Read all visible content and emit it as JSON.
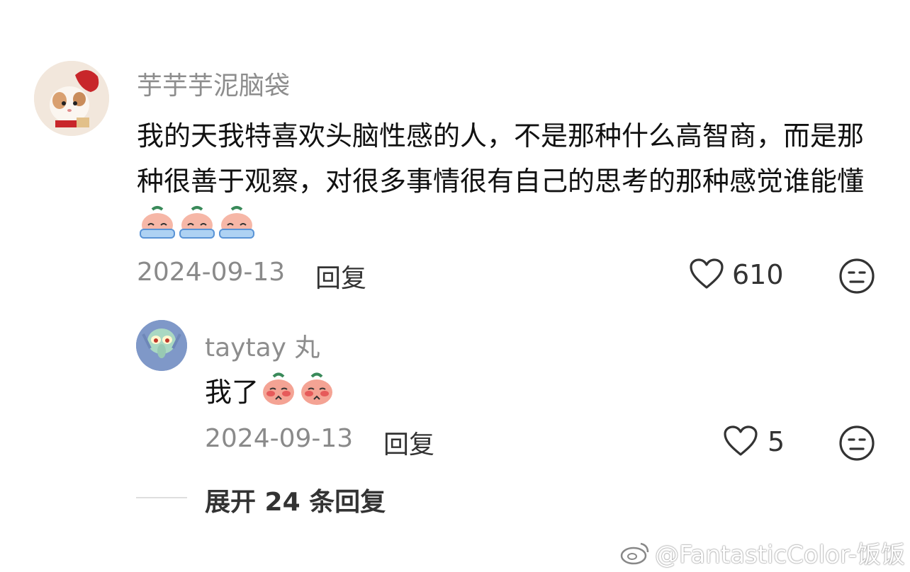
{
  "main_comment": {
    "username": "芋芋芋泥脑袋",
    "text": "我的天我特喜欢头脑性感的人，不是那种什么高智商，而是那种很善于观察，对很多事情很有自己的思考的那种感觉谁能懂",
    "emoji": "crying-emoji",
    "emoji_count": 3,
    "date": "2024-09-13",
    "reply_label": "回复",
    "likes": "610",
    "icons": {
      "like": "heart-outline-icon",
      "reaction": "meh-face-icon"
    }
  },
  "reply_comment": {
    "username": "taytay 丸",
    "text": "我了",
    "emoji": "blushing-emoji",
    "emoji_count": 2,
    "date": "2024-09-13",
    "reply_label": "回复",
    "likes": "5",
    "icons": {
      "like": "heart-outline-icon",
      "reaction": "meh-face-icon"
    }
  },
  "expand": {
    "label": "展开 24 条回复"
  },
  "watermark": {
    "text": "@FantasticColor-饭饭",
    "icon": "weibo-icon"
  },
  "colors": {
    "meta": "#8a8a8a",
    "username": "#8d8d8d",
    "text": "#111111",
    "divider": "#dedede"
  }
}
